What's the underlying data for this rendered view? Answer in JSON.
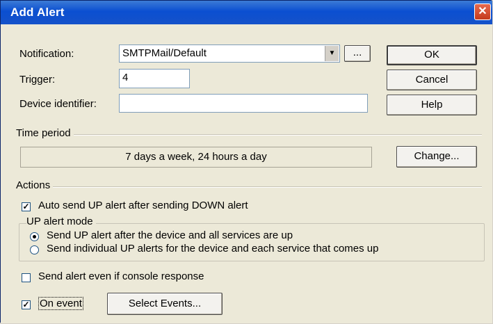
{
  "window": {
    "title": "Add Alert",
    "close_glyph": "✕"
  },
  "form": {
    "notification_label": "Notification:",
    "notification_value": "SMTPMail/Default",
    "browse_label": "...",
    "trigger_label": "Trigger:",
    "trigger_value": "4",
    "device_label": "Device identifier:",
    "device_value": ""
  },
  "buttons": {
    "ok": "OK",
    "cancel": "Cancel",
    "help": "Help",
    "change": "Change...",
    "select_events": "Select Events..."
  },
  "time_period": {
    "title": "Time period",
    "value": "7 days a week, 24 hours a day"
  },
  "actions": {
    "title": "Actions",
    "auto_send": {
      "label": "Auto send UP alert after sending DOWN alert",
      "checked": true
    },
    "up_alert_mode": {
      "title": "UP alert mode",
      "options": [
        {
          "label": "Send UP alert after the device and all services are up",
          "selected": true
        },
        {
          "label": "Send individual UP alerts for the device and each service that comes up",
          "selected": false
        }
      ]
    },
    "send_even": {
      "label": "Send alert even if console response",
      "checked": false
    },
    "on_event": {
      "label": "On event",
      "checked": true
    }
  },
  "icons": {
    "close": "close-icon",
    "dropdown": "chevron-down-icon",
    "check": "checkmark-icon",
    "radio": "radio-dot-icon"
  }
}
